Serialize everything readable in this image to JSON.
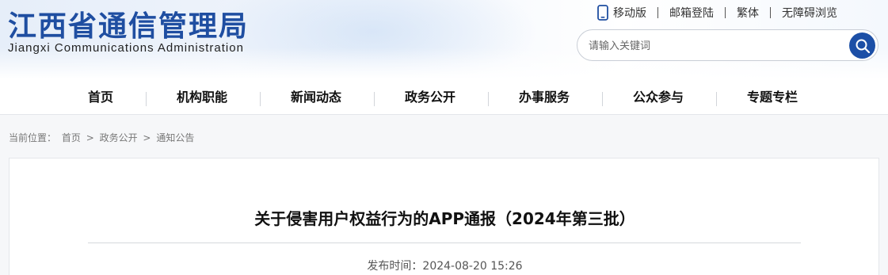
{
  "site": {
    "title_cn": "江西省通信管理局",
    "title_en": "Jiangxi Communications Administration"
  },
  "top_links": [
    {
      "label": "移动版",
      "icon": "mobile-phone-icon"
    },
    {
      "label": "邮箱登陆"
    },
    {
      "label": "繁体"
    },
    {
      "label": "无障碍浏览"
    }
  ],
  "search": {
    "placeholder": "请输入关键词",
    "button_icon": "search-icon"
  },
  "nav": {
    "items": [
      "首页",
      "机构职能",
      "新闻动态",
      "政务公开",
      "办事服务",
      "公众参与",
      "专题专栏"
    ]
  },
  "breadcrumb": {
    "prefix": "当前位置：",
    "items": [
      "首页",
      "政务公开",
      "通知公告"
    ],
    "separator": ">"
  },
  "article": {
    "title": "关于侵害用户权益行为的APP通报（2024年第三批）",
    "publish_label": "发布时间：",
    "publish_time": "2024-08-20 15:26"
  },
  "colors": {
    "brand": "#1f4ea1",
    "search_button": "#1c4fa6"
  }
}
